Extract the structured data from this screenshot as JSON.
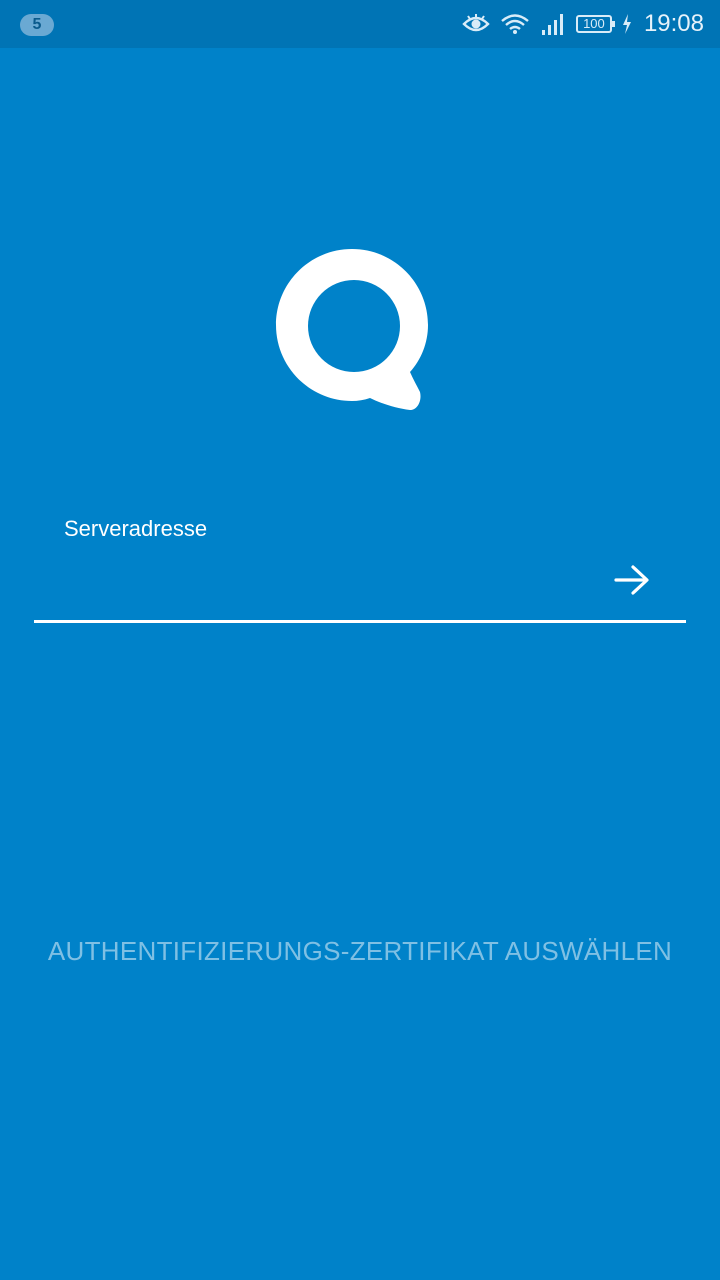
{
  "status_bar": {
    "notification_count": "5",
    "battery_level": "100",
    "time": "19:08",
    "icons": [
      "eye-comfort-icon",
      "wifi-icon",
      "signal-icon",
      "battery-icon",
      "charging-icon"
    ]
  },
  "logo": {
    "icon": "nextcloud-talk-logo"
  },
  "login": {
    "server_label": "Serveradresse",
    "server_value": "",
    "submit_icon": "arrow-right-icon"
  },
  "certificate_button": {
    "label": "AUTHENTIFIZIERUNGS-ZERTIFIKAT AUSWÄHLEN"
  },
  "colors": {
    "background": "#0082c9",
    "status_bar": "#0074b5",
    "accent_text": "#7fc0e4",
    "foreground": "#ffffff"
  }
}
